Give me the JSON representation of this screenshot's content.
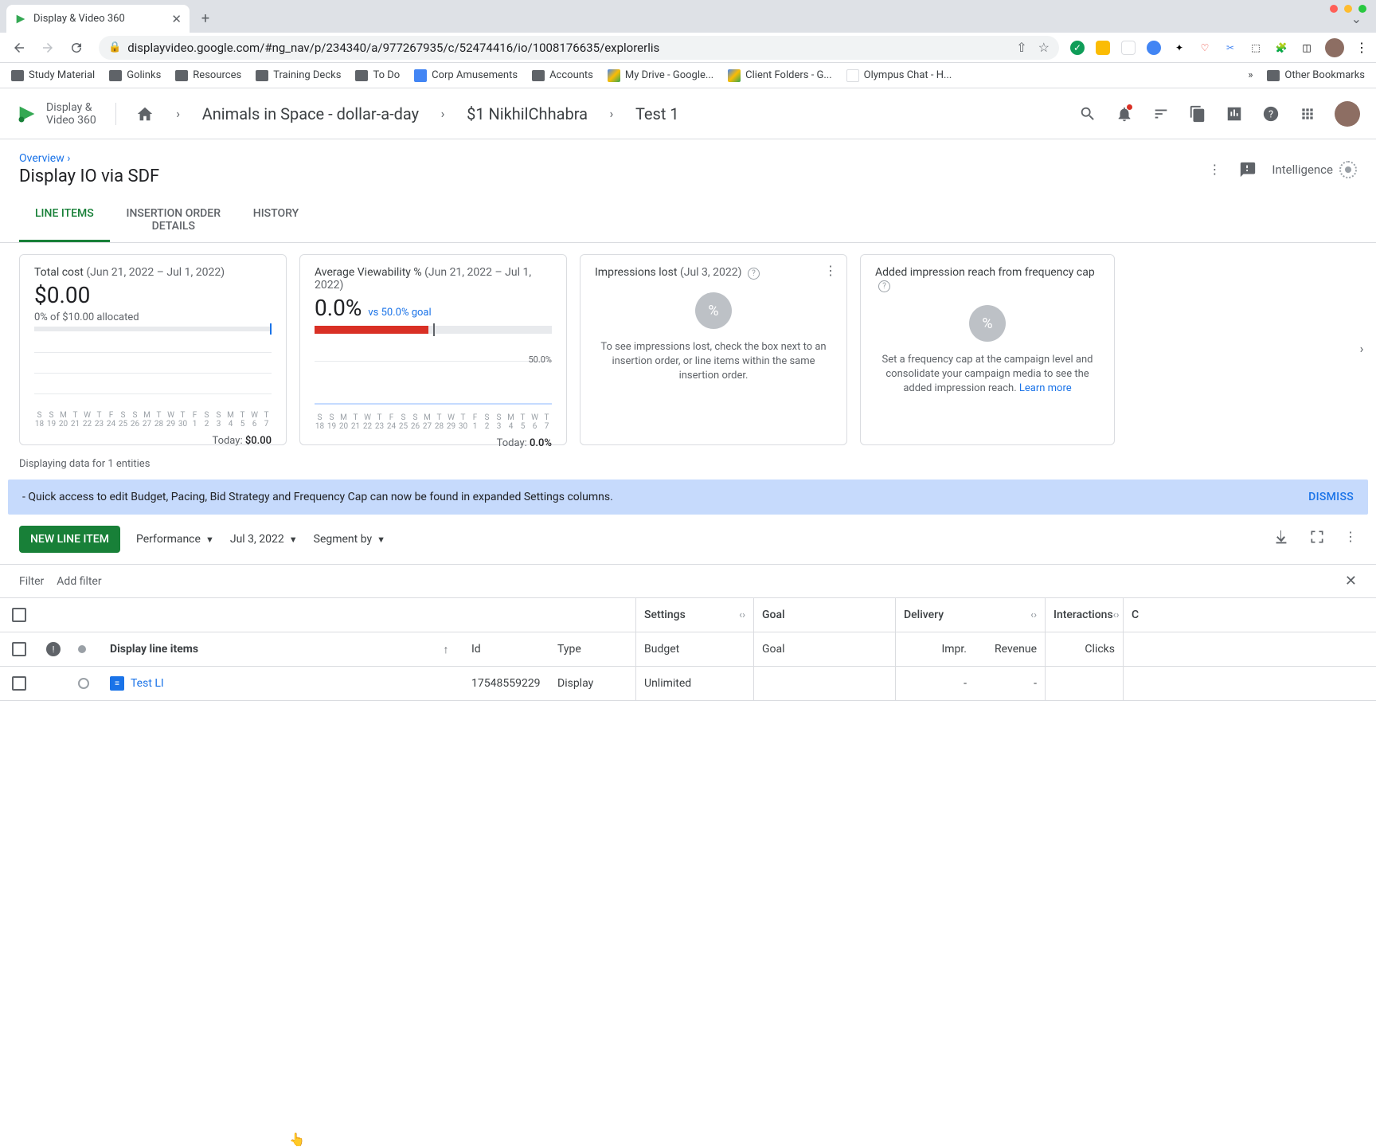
{
  "browser": {
    "tab_title": "Display & Video 360",
    "url": "displayvideo.google.com/#ng_nav/p/234340/a/977267935/c/52474416/io/1008176635/explorerlis",
    "bookmarks": [
      "Study Material",
      "Golinks",
      "Resources",
      "Training Decks",
      "To Do",
      "Corp Amusements",
      "Accounts",
      "My Drive - Google...",
      "Client Folders - G...",
      "Olympus Chat - H..."
    ],
    "bookmarks_overflow": "»",
    "other_bookmarks": "Other Bookmarks"
  },
  "header": {
    "product_line1": "Display &",
    "product_line2": "Video 360",
    "crumbs": [
      "Animals in Space - dollar-a-day",
      "$1 NikhilChhabra",
      "Test 1"
    ]
  },
  "page": {
    "overview": "Overview ›",
    "title": "Display IO via SDF",
    "intelligence_label": "Intelligence",
    "tabs": [
      "LINE ITEMS",
      "INSERTION ORDER DETAILS",
      "HISTORY"
    ]
  },
  "cards": {
    "total_cost": {
      "title": "Total cost",
      "range": "(Jun 21, 2022 – Jul 1, 2022)",
      "value": "$0.00",
      "alloc": "0% of $10.00 allocated",
      "today_label": "Today:",
      "today_value": "$0.00"
    },
    "viewability": {
      "title": "Average Viewability %",
      "range": "(Jun 21, 2022 – Jul 1, 2022)",
      "value": "0.0%",
      "goal": "vs 50.0% goal",
      "goal_line": "50.0%",
      "today_label": "Today:",
      "today_value": "0.0%"
    },
    "impressions_lost": {
      "title": "Impressions lost",
      "range": "(Jul 3, 2022)",
      "msg": "To see impressions lost, check the box next to an insertion order, or line items within the same insertion order."
    },
    "freq_cap": {
      "title": "Added impression reach from frequency cap",
      "msg": "Set a frequency cap at the campaign level and consolidate your campaign media to see the added impression reach. ",
      "link": "Learn more"
    },
    "axis_days": [
      "S",
      "S",
      "M",
      "T",
      "W",
      "T",
      "F",
      "S",
      "S",
      "M",
      "T",
      "W",
      "T",
      "F",
      "S",
      "S",
      "M",
      "T",
      "W",
      "T"
    ],
    "axis_dates_a": [
      "18",
      "19",
      "20",
      "21",
      "22",
      "23",
      "24",
      "25",
      "26",
      "27",
      "28",
      "29",
      "30",
      "1",
      "2",
      "3",
      "4",
      "5",
      "6",
      "7"
    ],
    "axis_dates_b": [
      "18",
      "19",
      "20",
      "21",
      "22",
      "23",
      "24",
      "25",
      "26",
      "27",
      "28",
      "29",
      "30",
      "1",
      "2",
      "3",
      "4",
      "5",
      "6",
      "7"
    ]
  },
  "entities_note": "Displaying data for 1 entities",
  "banner": {
    "text": "- Quick access to edit Budget, Pacing, Bid Strategy and Frequency Cap can now be found in expanded Settings columns.",
    "dismiss": "DISMISS"
  },
  "controls": {
    "new_btn": "NEW LINE ITEM",
    "performance": "Performance",
    "date": "Jul 3, 2022",
    "segment": "Segment by"
  },
  "filter": {
    "label": "Filter",
    "add": "Add filter"
  },
  "table": {
    "sections": {
      "settings": "Settings",
      "goal": "Goal",
      "delivery": "Delivery",
      "interactions": "Interactions",
      "last": "C"
    },
    "head2": {
      "name": "Display line items",
      "id": "Id",
      "type": "Type",
      "budget": "Budget",
      "goal": "Goal",
      "impr": "Impr.",
      "revenue": "Revenue",
      "clicks": "Clicks"
    },
    "row": {
      "name": "Test LI",
      "id": "17548559229",
      "type": "Display",
      "budget": "Unlimited",
      "goal": "",
      "impr": "-",
      "revenue": "-",
      "clicks": ""
    }
  }
}
